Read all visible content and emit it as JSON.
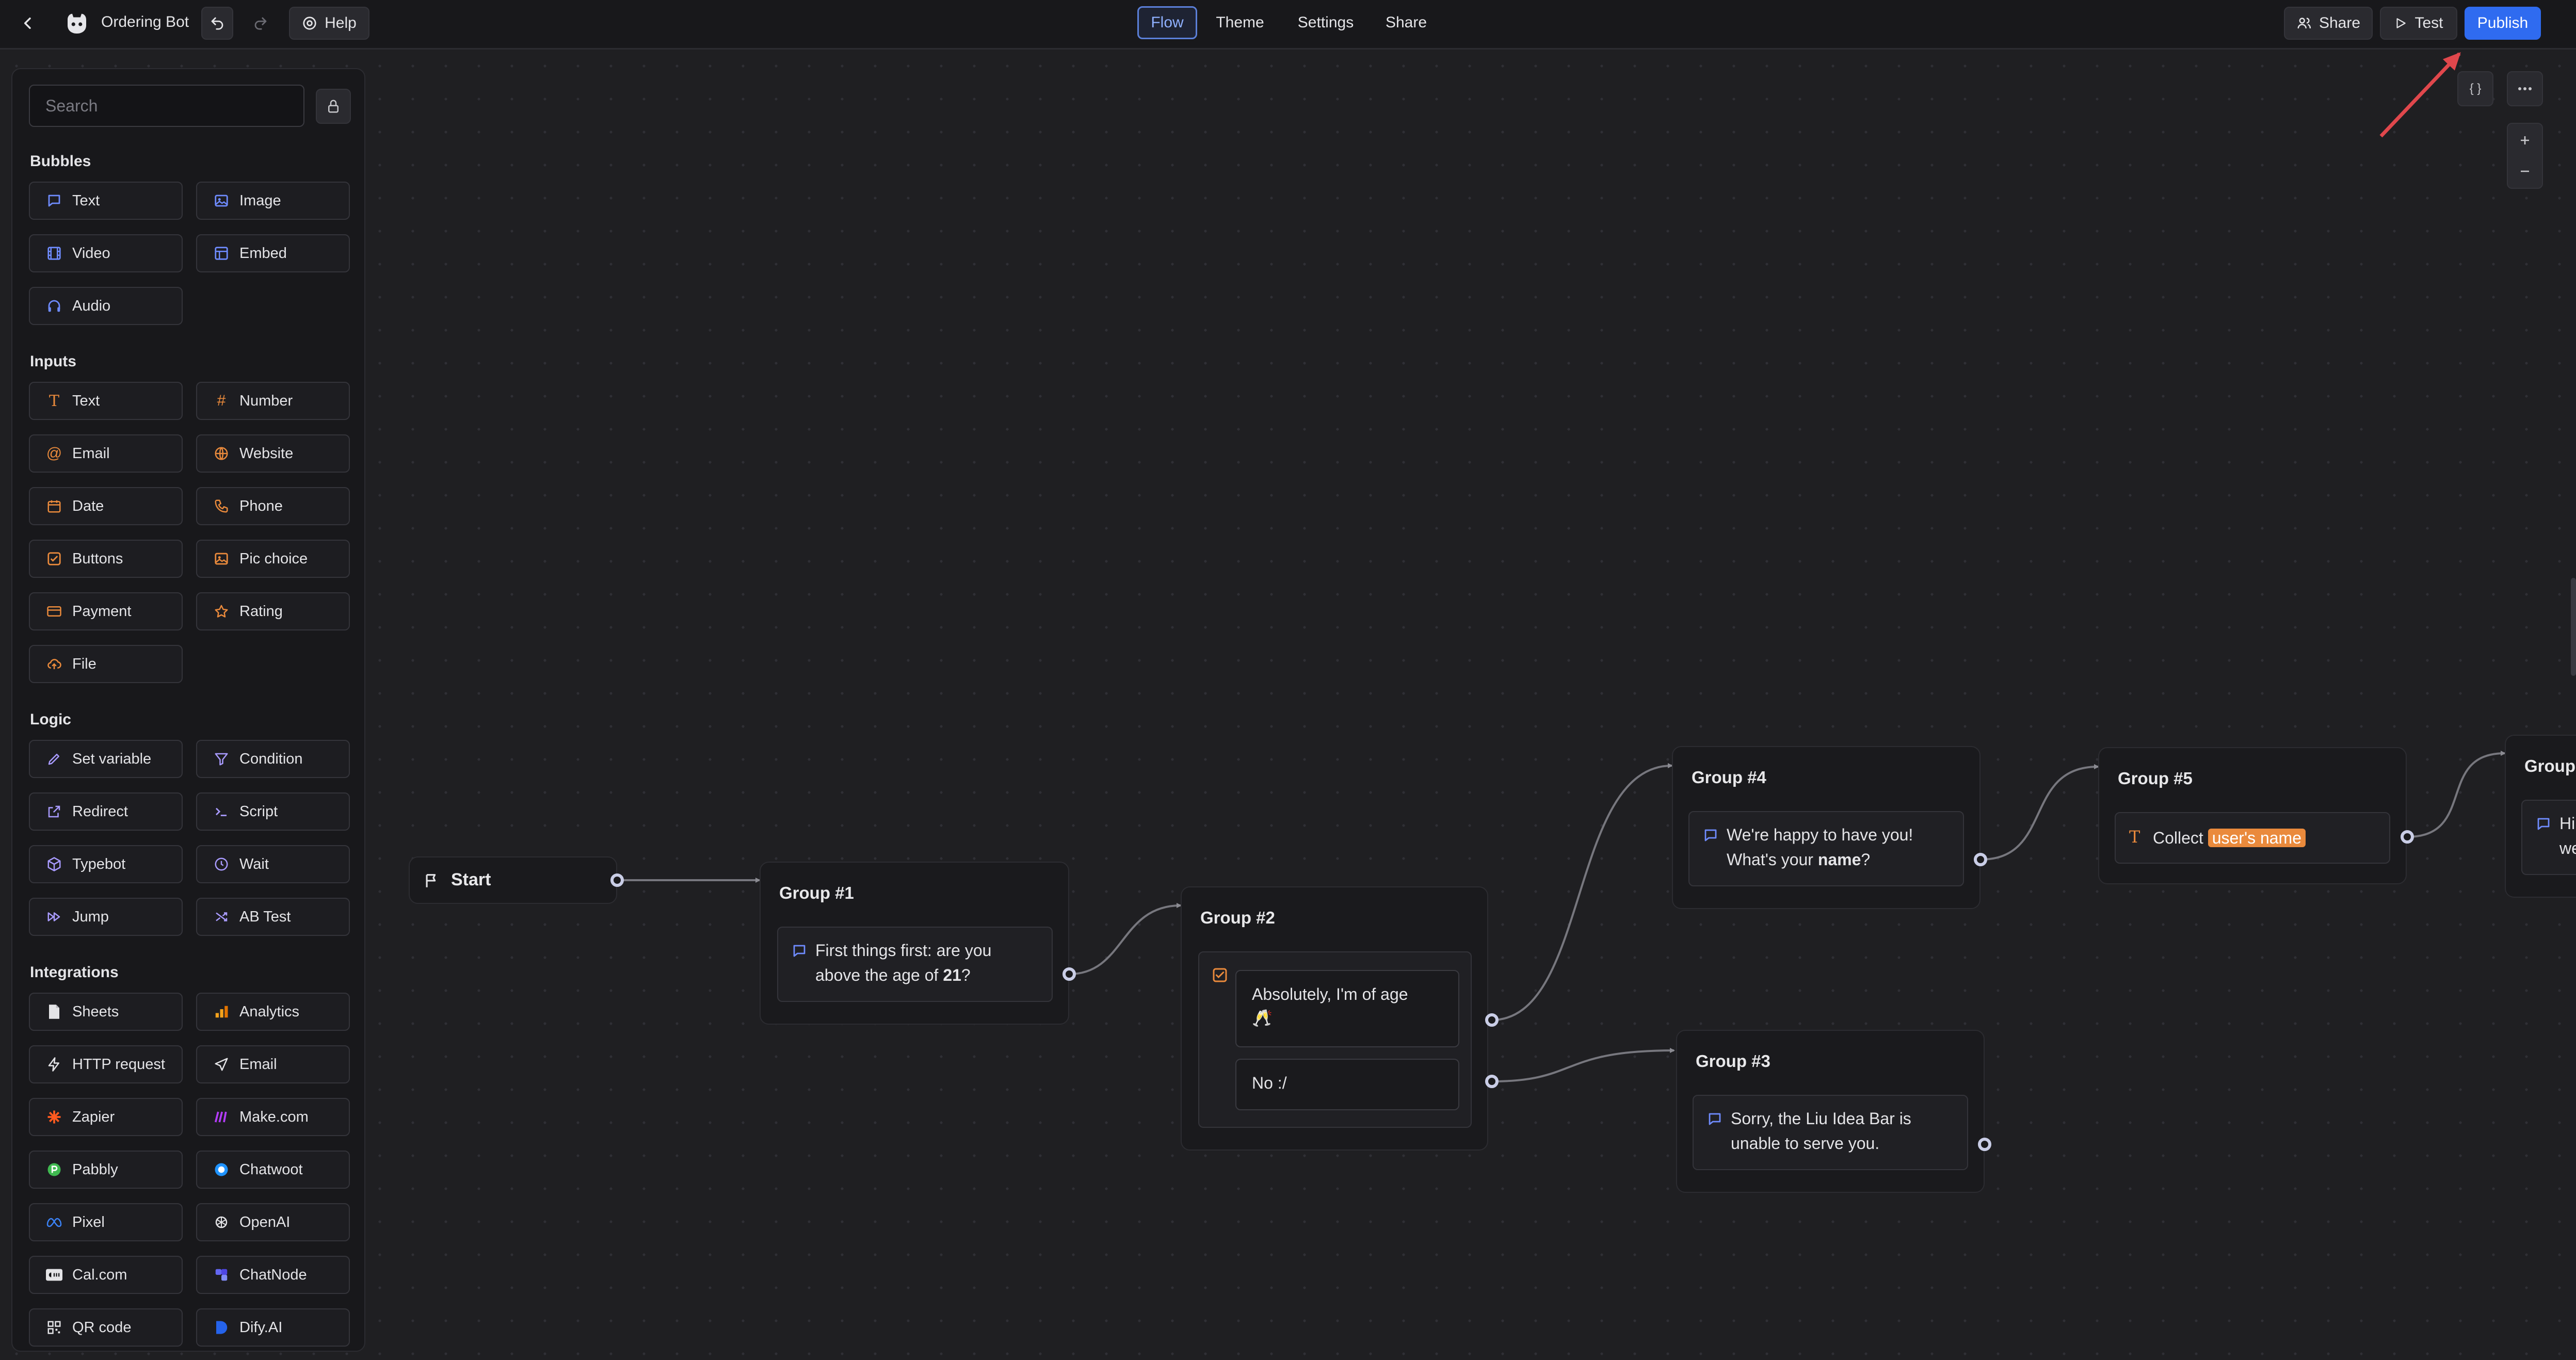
{
  "topbar": {
    "bot_name": "Ordering Bot",
    "help_label": "Help",
    "tabs": [
      {
        "label": "Flow",
        "active": true
      },
      {
        "label": "Theme"
      },
      {
        "label": "Settings"
      },
      {
        "label": "Share"
      }
    ],
    "share_label": "Share",
    "test_label": "Test",
    "publish_label": "Publish"
  },
  "sidebar": {
    "search_placeholder": "Search",
    "sections": {
      "bubbles": {
        "title": "Bubbles",
        "items": [
          {
            "label": "Text",
            "icon": "chat-bubble-icon"
          },
          {
            "label": "Image",
            "icon": "image-icon"
          },
          {
            "label": "Video",
            "icon": "film-icon"
          },
          {
            "label": "Embed",
            "icon": "layout-icon"
          },
          {
            "label": "Audio",
            "icon": "headphones-icon"
          }
        ]
      },
      "inputs": {
        "title": "Inputs",
        "items": [
          {
            "label": "Text",
            "icon": "text-t-icon"
          },
          {
            "label": "Number",
            "icon": "hash-icon"
          },
          {
            "label": "Email",
            "icon": "at-sign-icon"
          },
          {
            "label": "Website",
            "icon": "globe-icon"
          },
          {
            "label": "Date",
            "icon": "calendar-icon"
          },
          {
            "label": "Phone",
            "icon": "phone-icon"
          },
          {
            "label": "Buttons",
            "icon": "checkbox-icon"
          },
          {
            "label": "Pic choice",
            "icon": "image-icon"
          },
          {
            "label": "Payment",
            "icon": "credit-card-icon"
          },
          {
            "label": "Rating",
            "icon": "star-icon"
          },
          {
            "label": "File",
            "icon": "upload-cloud-icon"
          }
        ]
      },
      "logic": {
        "title": "Logic",
        "items": [
          {
            "label": "Set variable",
            "icon": "pen-icon"
          },
          {
            "label": "Condition",
            "icon": "filter-icon"
          },
          {
            "label": "Redirect",
            "icon": "external-link-icon"
          },
          {
            "label": "Script",
            "icon": "terminal-icon"
          },
          {
            "label": "Typebot",
            "icon": "box-icon"
          },
          {
            "label": "Wait",
            "icon": "clock-icon"
          },
          {
            "label": "Jump",
            "icon": "fast-forward-icon"
          },
          {
            "label": "AB Test",
            "icon": "shuffle-icon"
          }
        ]
      },
      "integrations": {
        "title": "Integrations",
        "items": [
          {
            "label": "Sheets",
            "icon": "sheets-icon"
          },
          {
            "label": "Analytics",
            "icon": "analytics-icon"
          },
          {
            "label": "HTTP request",
            "icon": "lightning-icon"
          },
          {
            "label": "Email",
            "icon": "send-icon"
          },
          {
            "label": "Zapier",
            "icon": "zapier-icon"
          },
          {
            "label": "Make.com",
            "icon": "make-icon"
          },
          {
            "label": "Pabbly",
            "icon": "pabbly-icon"
          },
          {
            "label": "Chatwoot",
            "icon": "chatwoot-icon"
          },
          {
            "label": "Pixel",
            "icon": "meta-icon"
          },
          {
            "label": "OpenAI",
            "icon": "openai-icon"
          },
          {
            "label": "Cal.com",
            "icon": "calcom-icon"
          },
          {
            "label": "ChatNode",
            "icon": "chatnode-icon"
          },
          {
            "label": "QR code",
            "icon": "qr-code-icon"
          },
          {
            "label": "Dify.AI",
            "icon": "dify-icon"
          }
        ]
      }
    }
  },
  "flow": {
    "start": {
      "label": "Start"
    },
    "group1": {
      "title": "Group #1",
      "text_a": "First things first: are you",
      "text_b": "above the age of ",
      "bold": "21",
      "text_c": "?"
    },
    "group2": {
      "title": "Group #2",
      "button1_line1": "Absolutely, I'm of age",
      "button1_emoji": "🥂",
      "button2": "No :/"
    },
    "group3": {
      "title": "Group #3",
      "line1": "Sorry, the Liu Idea Bar is",
      "line2": "unable to serve you."
    },
    "group4": {
      "title": "Group #4",
      "line1": "We're happy to have you!",
      "line2_a": "What's your ",
      "bold": "name",
      "line2_b": "?"
    },
    "group5": {
      "title": "Group #5",
      "collect_label": "Collect",
      "variable": "user's name"
    },
    "group6": {
      "title_partial": "Group",
      "line1_partial": "Hi",
      "line2_partial": "we"
    }
  },
  "colors": {
    "accent": "#2f6bf0",
    "bubble_icon": "#6f8cff",
    "input_icon": "#ea8a3c",
    "logic_icon": "#a99bff",
    "annotation_arrow": "#e0474c"
  }
}
